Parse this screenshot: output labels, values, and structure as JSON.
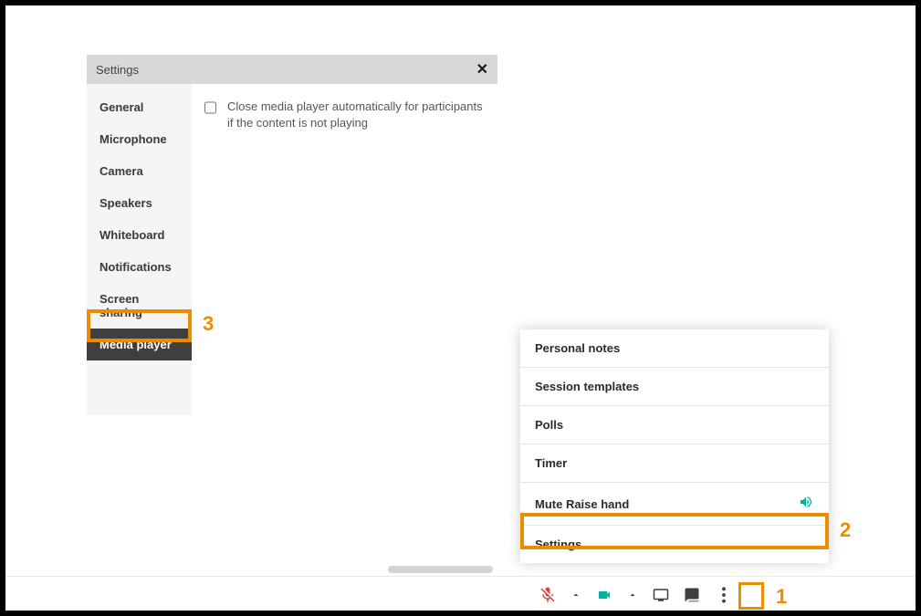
{
  "settings_panel": {
    "title": "Settings",
    "tabs": [
      {
        "label": "General"
      },
      {
        "label": "Microphone"
      },
      {
        "label": "Camera"
      },
      {
        "label": "Speakers"
      },
      {
        "label": "Whiteboard"
      },
      {
        "label": "Notifications"
      },
      {
        "label": "Screen sharing"
      },
      {
        "label": "Media player"
      }
    ],
    "content": {
      "auto_close_label": "Close media player automatically for participants if the content is not playing"
    }
  },
  "popup_menu": {
    "items": [
      {
        "label": "Personal notes"
      },
      {
        "label": "Session templates"
      },
      {
        "label": "Polls"
      },
      {
        "label": "Timer"
      },
      {
        "label": "Mute Raise hand"
      },
      {
        "label": "Settings"
      }
    ]
  },
  "callouts": {
    "one": "1",
    "two": "2",
    "three": "3"
  },
  "icons": {
    "close": "✕",
    "sound": "🔊",
    "mic_muted": "mic-muted",
    "camera": "camera",
    "screen": "screen",
    "chat": "chat",
    "more": "more"
  },
  "colors": {
    "accent": "#ee8c00",
    "teal": "#00b29a"
  }
}
